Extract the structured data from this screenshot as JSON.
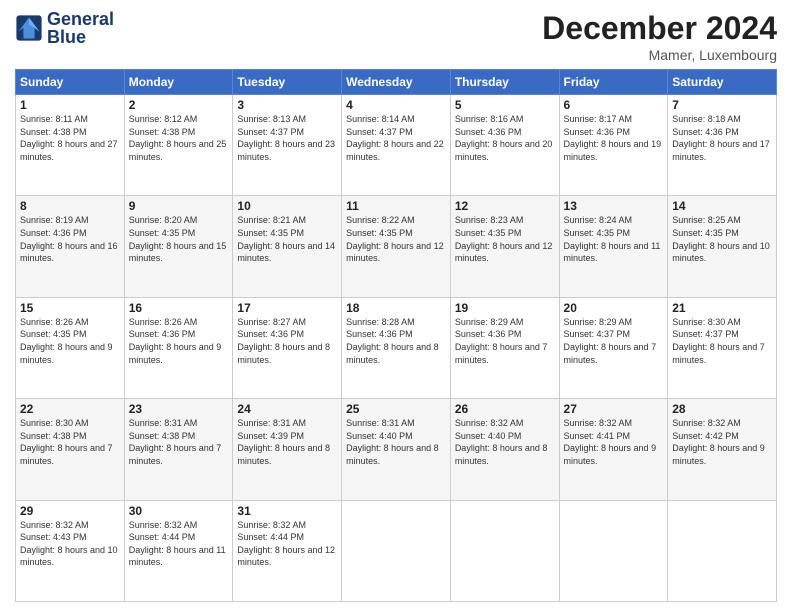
{
  "header": {
    "logo_line1": "General",
    "logo_line2": "Blue",
    "month_title": "December 2024",
    "location": "Mamer, Luxembourg"
  },
  "weekdays": [
    "Sunday",
    "Monday",
    "Tuesday",
    "Wednesday",
    "Thursday",
    "Friday",
    "Saturday"
  ],
  "weeks": [
    [
      {
        "day": "1",
        "sunrise": "8:11 AM",
        "sunset": "4:38 PM",
        "daylight": "8 hours and 27 minutes."
      },
      {
        "day": "2",
        "sunrise": "8:12 AM",
        "sunset": "4:38 PM",
        "daylight": "8 hours and 25 minutes."
      },
      {
        "day": "3",
        "sunrise": "8:13 AM",
        "sunset": "4:37 PM",
        "daylight": "8 hours and 23 minutes."
      },
      {
        "day": "4",
        "sunrise": "8:14 AM",
        "sunset": "4:37 PM",
        "daylight": "8 hours and 22 minutes."
      },
      {
        "day": "5",
        "sunrise": "8:16 AM",
        "sunset": "4:36 PM",
        "daylight": "8 hours and 20 minutes."
      },
      {
        "day": "6",
        "sunrise": "8:17 AM",
        "sunset": "4:36 PM",
        "daylight": "8 hours and 19 minutes."
      },
      {
        "day": "7",
        "sunrise": "8:18 AM",
        "sunset": "4:36 PM",
        "daylight": "8 hours and 17 minutes."
      }
    ],
    [
      {
        "day": "8",
        "sunrise": "8:19 AM",
        "sunset": "4:36 PM",
        "daylight": "8 hours and 16 minutes."
      },
      {
        "day": "9",
        "sunrise": "8:20 AM",
        "sunset": "4:35 PM",
        "daylight": "8 hours and 15 minutes."
      },
      {
        "day": "10",
        "sunrise": "8:21 AM",
        "sunset": "4:35 PM",
        "daylight": "8 hours and 14 minutes."
      },
      {
        "day": "11",
        "sunrise": "8:22 AM",
        "sunset": "4:35 PM",
        "daylight": "8 hours and 12 minutes."
      },
      {
        "day": "12",
        "sunrise": "8:23 AM",
        "sunset": "4:35 PM",
        "daylight": "8 hours and 12 minutes."
      },
      {
        "day": "13",
        "sunrise": "8:24 AM",
        "sunset": "4:35 PM",
        "daylight": "8 hours and 11 minutes."
      },
      {
        "day": "14",
        "sunrise": "8:25 AM",
        "sunset": "4:35 PM",
        "daylight": "8 hours and 10 minutes."
      }
    ],
    [
      {
        "day": "15",
        "sunrise": "8:26 AM",
        "sunset": "4:35 PM",
        "daylight": "8 hours and 9 minutes."
      },
      {
        "day": "16",
        "sunrise": "8:26 AM",
        "sunset": "4:36 PM",
        "daylight": "8 hours and 9 minutes."
      },
      {
        "day": "17",
        "sunrise": "8:27 AM",
        "sunset": "4:36 PM",
        "daylight": "8 hours and 8 minutes."
      },
      {
        "day": "18",
        "sunrise": "8:28 AM",
        "sunset": "4:36 PM",
        "daylight": "8 hours and 8 minutes."
      },
      {
        "day": "19",
        "sunrise": "8:29 AM",
        "sunset": "4:36 PM",
        "daylight": "8 hours and 7 minutes."
      },
      {
        "day": "20",
        "sunrise": "8:29 AM",
        "sunset": "4:37 PM",
        "daylight": "8 hours and 7 minutes."
      },
      {
        "day": "21",
        "sunrise": "8:30 AM",
        "sunset": "4:37 PM",
        "daylight": "8 hours and 7 minutes."
      }
    ],
    [
      {
        "day": "22",
        "sunrise": "8:30 AM",
        "sunset": "4:38 PM",
        "daylight": "8 hours and 7 minutes."
      },
      {
        "day": "23",
        "sunrise": "8:31 AM",
        "sunset": "4:38 PM",
        "daylight": "8 hours and 7 minutes."
      },
      {
        "day": "24",
        "sunrise": "8:31 AM",
        "sunset": "4:39 PM",
        "daylight": "8 hours and 8 minutes."
      },
      {
        "day": "25",
        "sunrise": "8:31 AM",
        "sunset": "4:40 PM",
        "daylight": "8 hours and 8 minutes."
      },
      {
        "day": "26",
        "sunrise": "8:32 AM",
        "sunset": "4:40 PM",
        "daylight": "8 hours and 8 minutes."
      },
      {
        "day": "27",
        "sunrise": "8:32 AM",
        "sunset": "4:41 PM",
        "daylight": "8 hours and 9 minutes."
      },
      {
        "day": "28",
        "sunrise": "8:32 AM",
        "sunset": "4:42 PM",
        "daylight": "8 hours and 9 minutes."
      }
    ],
    [
      {
        "day": "29",
        "sunrise": "8:32 AM",
        "sunset": "4:43 PM",
        "daylight": "8 hours and 10 minutes."
      },
      {
        "day": "30",
        "sunrise": "8:32 AM",
        "sunset": "4:44 PM",
        "daylight": "8 hours and 11 minutes."
      },
      {
        "day": "31",
        "sunrise": "8:32 AM",
        "sunset": "4:44 PM",
        "daylight": "8 hours and 12 minutes."
      },
      null,
      null,
      null,
      null
    ]
  ]
}
